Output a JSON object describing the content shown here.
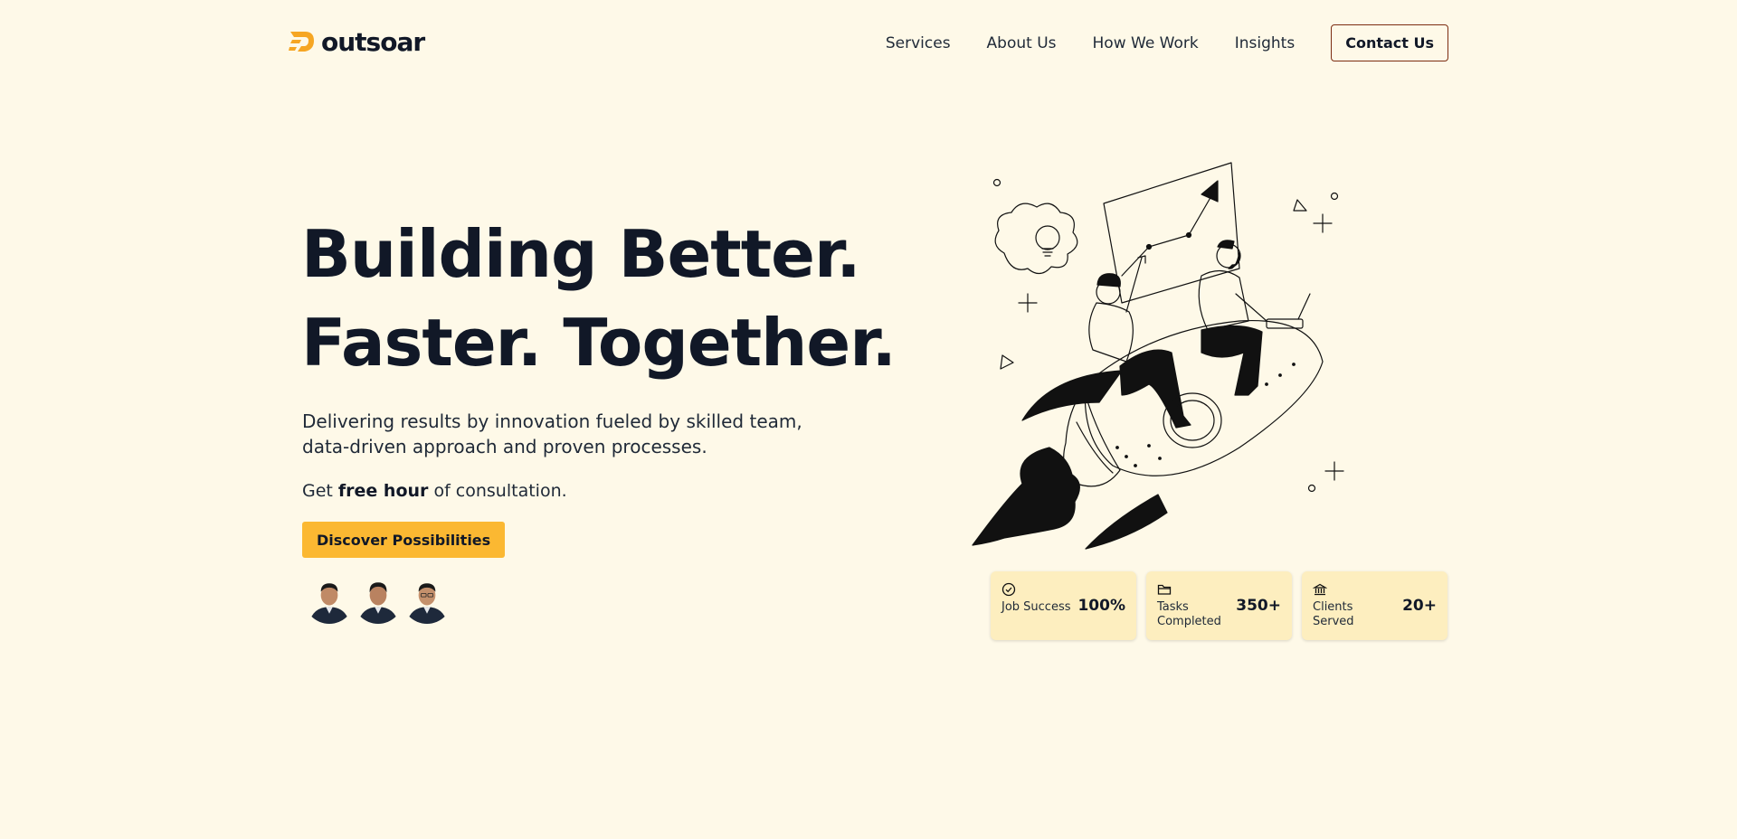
{
  "header": {
    "logo_text": "outsoar",
    "nav": [
      "Services",
      "About Us",
      "How We Work",
      "Insights"
    ],
    "contact_label": "Contact Us"
  },
  "hero": {
    "title_line1": "Building Better.",
    "title_line2": "Faster. Together.",
    "subtitle": "Delivering results by innovation fueled by skilled team, data-driven approach and proven processes.",
    "offer_prefix": "Get ",
    "offer_bold": "free hour",
    "offer_suffix": " of consultation.",
    "cta_label": "Discover Possibilities",
    "avatar_count": 3
  },
  "stats": [
    {
      "icon": "check-circle-icon",
      "label": "Job Success",
      "value": "100%"
    },
    {
      "icon": "folder-icon",
      "label": "Tasks Completed",
      "value": "350+"
    },
    {
      "icon": "bank-icon",
      "label": "Clients Served",
      "value": "20+"
    }
  ],
  "colors": {
    "background": "#fef9e8",
    "accent": "#fbb832",
    "stat_card": "#fdeebf",
    "contact_border": "#7c2d12",
    "text": "#111827"
  }
}
